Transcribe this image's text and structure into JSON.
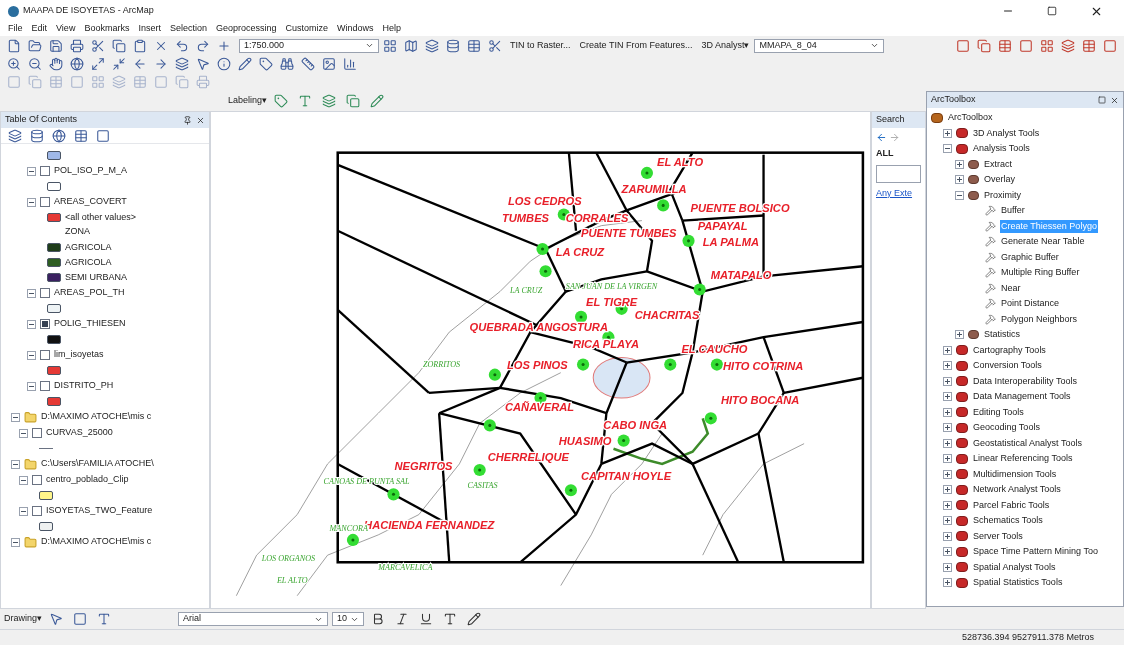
{
  "window": {
    "title": "MAAPA DE ISOYETAS - ArcMap"
  },
  "menu": [
    "File",
    "Edit",
    "View",
    "Bookmarks",
    "Insert",
    "Selection",
    "Geoprocessing",
    "Customize",
    "Windows",
    "Help"
  ],
  "toolbar": {
    "scale": "1:750.000",
    "tin_commands": [
      "TIN to Raster...",
      "Create TIN From Features..."
    ],
    "analyst_menu": "3D Analyst▾",
    "layer": "MMAPA_8_04",
    "labeling_menu": "Labeling▾"
  },
  "toc": {
    "title": "Table Of Contents",
    "items": [
      {
        "kind": "continued",
        "children": [
          {
            "kind": "swatch",
            "color": "#9fb8e8"
          },
          {
            "kind": "layer",
            "label": "POL_ISO_P_M_A",
            "checked": false,
            "expanded": true,
            "children": [
              {
                "kind": "swatch",
                "color": "#ffffff"
              }
            ]
          },
          {
            "kind": "layer",
            "label": "AREAS_COVERT",
            "checked": false,
            "expanded": true,
            "children": [
              {
                "kind": "swatch",
                "label": "<all other values>",
                "color": "#e53935"
              },
              {
                "kind": "heading",
                "label": "ZONA"
              },
              {
                "kind": "swatch",
                "label": "AGRICOLA",
                "color": "#1f3d1a"
              },
              {
                "kind": "swatch",
                "label": "AGRICOLA",
                "color": "#2e5e22"
              },
              {
                "kind": "swatch",
                "label": "SEMI URBANA",
                "color": "#3a2060"
              }
            ]
          },
          {
            "kind": "layer",
            "label": "AREAS_POL_TH",
            "checked": false,
            "expanded": true,
            "children": [
              {
                "kind": "swatch",
                "color": "#eef3f5"
              }
            ]
          },
          {
            "kind": "layer",
            "label": "POLIG_THIESEN",
            "checked": true,
            "expanded": true,
            "children": [
              {
                "kind": "swatch",
                "color": "#111111"
              }
            ]
          },
          {
            "kind": "layer",
            "label": "lim_isoyetas",
            "checked": false,
            "expanded": true,
            "children": [
              {
                "kind": "swatch",
                "color": "#e53935"
              }
            ]
          },
          {
            "kind": "layer",
            "label": "DISTRITO_PH",
            "checked": false,
            "expanded": true,
            "children": [
              {
                "kind": "swatch",
                "color": "#e53935"
              }
            ]
          }
        ]
      },
      {
        "kind": "group",
        "label": "D:\\MAXIMO ATOCHE\\mis c",
        "expanded": true,
        "children": [
          {
            "kind": "layer",
            "label": "CURVAS_25000",
            "checked": false,
            "expanded": true,
            "children": [
              {
                "kind": "line"
              }
            ]
          }
        ]
      },
      {
        "kind": "group",
        "label": "C:\\Users\\FAMILIA ATOCHE\\",
        "expanded": true,
        "children": [
          {
            "kind": "layer",
            "label": "centro_poblado_Clip",
            "checked": false,
            "expanded": true,
            "children": [
              {
                "kind": "swatch",
                "color": "#fff68a"
              }
            ]
          },
          {
            "kind": "layer",
            "label": "ISOYETAS_TWO_Feature",
            "checked": false,
            "expanded": true,
            "children": [
              {
                "kind": "swatch",
                "color": "#eef0f0"
              }
            ]
          }
        ]
      },
      {
        "kind": "group",
        "label": "D:\\MAXIMO ATOCHE\\mis c",
        "expanded": true
      }
    ]
  },
  "map": {
    "labels": [
      {
        "text": "EL ALTO",
        "kind": "place"
      },
      {
        "text": "ZARUMILLA",
        "kind": "place"
      },
      {
        "text": "LOS CEDROS",
        "kind": "place"
      },
      {
        "text": "PUENTE BOLSICO",
        "kind": "place"
      },
      {
        "text": "TUMBES",
        "kind": "place"
      },
      {
        "text": "CORRALES",
        "kind": "place"
      },
      {
        "text": "PUENTE TUMBES",
        "kind": "place"
      },
      {
        "text": "PAPAYAL",
        "kind": "place"
      },
      {
        "text": "LA PALMA",
        "kind": "place"
      },
      {
        "text": "LA CRUZ",
        "kind": "place"
      },
      {
        "text": "MATAPALO",
        "kind": "place"
      },
      {
        "text": "EL TIGRE",
        "kind": "place"
      },
      {
        "text": "CHACRITAS",
        "kind": "place"
      },
      {
        "text": "QUEBRADA ANGOSTURA",
        "kind": "place"
      },
      {
        "text": "RICA PLAYA",
        "kind": "place"
      },
      {
        "text": "EL CAUCHO",
        "kind": "place"
      },
      {
        "text": "LOS PINOS",
        "kind": "place"
      },
      {
        "text": "HITO COTRINA",
        "kind": "place"
      },
      {
        "text": "CAÑAVERAL",
        "kind": "place"
      },
      {
        "text": "HITO BOCANA",
        "kind": "place"
      },
      {
        "text": "CABO INGA",
        "kind": "place"
      },
      {
        "text": "HUASIMO",
        "kind": "place"
      },
      {
        "text": "CHERRELIQUE",
        "kind": "place"
      },
      {
        "text": "NEGRITOS",
        "kind": "place"
      },
      {
        "text": "CAPITAN HOYLE",
        "kind": "place"
      },
      {
        "text": "HACIENDA FERNANDEZ",
        "kind": "place"
      },
      {
        "text": "SAN JUAN DE LA VIRGEN",
        "kind": "village"
      },
      {
        "text": "LA CRUZ",
        "kind": "village"
      },
      {
        "text": "ZORRITOS",
        "kind": "village"
      },
      {
        "text": "CASITAS",
        "kind": "village"
      },
      {
        "text": "CANOAS DE PUNTA SAL",
        "kind": "village"
      },
      {
        "text": "MANCORA",
        "kind": "village"
      },
      {
        "text": "LOS ORGANOS",
        "kind": "village"
      },
      {
        "text": "MARCAVELICA",
        "kind": "village"
      },
      {
        "text": "EL ALTO",
        "kind": "village"
      }
    ]
  },
  "search": {
    "title": "Search",
    "tab": "ALL",
    "link": "Any Exte"
  },
  "toolbox": {
    "title": "ArcToolbox",
    "items": [
      {
        "kind": "root",
        "label": "ArcToolbox",
        "children": [
          {
            "kind": "toolbox",
            "label": "3D Analyst Tools",
            "expanded": false
          },
          {
            "kind": "toolbox",
            "label": "Analysis Tools",
            "expanded": true,
            "children": [
              {
                "kind": "toolset",
                "label": "Extract",
                "expanded": false
              },
              {
                "kind": "toolset",
                "label": "Overlay",
                "expanded": false
              },
              {
                "kind": "toolset",
                "label": "Proximity",
                "expanded": true,
                "children": [
                  {
                    "kind": "tool",
                    "label": "Buffer",
                    "selected": false
                  },
                  {
                    "kind": "tool",
                    "label": "Create Thiessen Polygo",
                    "selected": true
                  },
                  {
                    "kind": "tool",
                    "label": "Generate Near Table",
                    "selected": false
                  },
                  {
                    "kind": "tool",
                    "label": "Graphic Buffer",
                    "selected": false
                  },
                  {
                    "kind": "tool",
                    "label": "Multiple Ring Buffer",
                    "selected": false
                  },
                  {
                    "kind": "tool",
                    "label": "Near",
                    "selected": false
                  },
                  {
                    "kind": "tool",
                    "label": "Point Distance",
                    "selected": false
                  },
                  {
                    "kind": "tool",
                    "label": "Polygon Neighbors",
                    "selected": false
                  }
                ]
              },
              {
                "kind": "toolset",
                "label": "Statistics",
                "expanded": false
              }
            ]
          },
          {
            "kind": "toolbox",
            "label": "Cartography Tools",
            "expanded": false
          },
          {
            "kind": "toolbox",
            "label": "Conversion Tools",
            "expanded": false
          },
          {
            "kind": "toolbox",
            "label": "Data Interoperability Tools",
            "expanded": false
          },
          {
            "kind": "toolbox",
            "label": "Data Management Tools",
            "expanded": false
          },
          {
            "kind": "toolbox",
            "label": "Editing Tools",
            "expanded": false
          },
          {
            "kind": "toolbox",
            "label": "Geocoding Tools",
            "expanded": false
          },
          {
            "kind": "toolbox",
            "label": "Geostatistical Analyst Tools",
            "expanded": false
          },
          {
            "kind": "toolbox",
            "label": "Linear Referencing Tools",
            "expanded": false
          },
          {
            "kind": "toolbox",
            "label": "Multidimension Tools",
            "expanded": false
          },
          {
            "kind": "toolbox",
            "label": "Network Analyst Tools",
            "expanded": false
          },
          {
            "kind": "toolbox",
            "label": "Parcel Fabric Tools",
            "expanded": false
          },
          {
            "kind": "toolbox",
            "label": "Schematics Tools",
            "expanded": false
          },
          {
            "kind": "toolbox",
            "label": "Server Tools",
            "expanded": false
          },
          {
            "kind": "toolbox",
            "label": "Space Time Pattern Mining Too",
            "expanded": false
          },
          {
            "kind": "toolbox",
            "label": "Spatial Analyst Tools",
            "expanded": false
          },
          {
            "kind": "toolbox",
            "label": "Spatial Statistics Tools",
            "expanded": false
          }
        ]
      }
    ]
  },
  "drawing": {
    "menu": "Drawing▾",
    "font": "Arial",
    "size": "10"
  },
  "status_bar": {
    "coordinates": "528736.394 9527911.378 Metros"
  }
}
